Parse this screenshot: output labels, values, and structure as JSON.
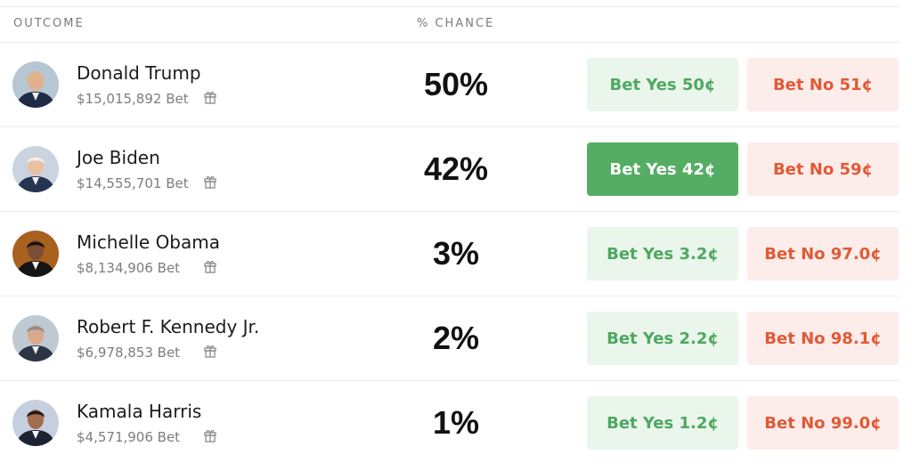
{
  "header": {
    "outcome_label": "OUTCOME",
    "chance_label": "% CHANCE"
  },
  "rows": [
    {
      "name": "Donald Trump",
      "volume": "$15,015,892 Bet",
      "chance": "50%",
      "bet_yes": "Bet Yes 50¢",
      "bet_no": "Bet No 51¢",
      "avatar_bg": "#b7c6d3",
      "suit": "#1f2a44",
      "hair": "#d9b98a",
      "skin": "#e2b08f"
    },
    {
      "name": "Joe Biden",
      "volume": "$14,555,701 Bet",
      "chance": "42%",
      "bet_yes": "Bet Yes 42¢",
      "bet_no": "Bet No 59¢",
      "avatar_bg": "#c9d4e0",
      "suit": "#243451",
      "hair": "#eeeeee",
      "skin": "#e8c0a4"
    },
    {
      "name": "Michelle Obama",
      "volume": "$8,134,906 Bet",
      "chance": "3%",
      "bet_yes": "Bet Yes 3.2¢",
      "bet_no": "Bet No 97.0¢",
      "avatar_bg": "#a8611f",
      "suit": "#151515",
      "hair": "#1a1310",
      "skin": "#7b4d33"
    },
    {
      "name": "Robert F. Kennedy Jr.",
      "volume": "$6,978,853 Bet",
      "chance": "2%",
      "bet_yes": "Bet Yes 2.2¢",
      "bet_no": "Bet No 98.1¢",
      "avatar_bg": "#bfc9d2",
      "suit": "#2c3445",
      "hair": "#8e8e8e",
      "skin": "#d9a98c"
    },
    {
      "name": "Kamala Harris",
      "volume": "$4,571,906 Bet",
      "chance": "1%",
      "bet_yes": "Bet Yes 1.2¢",
      "bet_no": "Bet No 99.0¢",
      "avatar_bg": "#c6cfe0",
      "suit": "#1d2233",
      "hair": "#241812",
      "skin": "#a46d4e"
    }
  ],
  "active_bet_row": 1,
  "colors": {
    "yes_text": "#4ea85f",
    "yes_bg": "#eaf5ec",
    "yes_active_bg": "#55ad63",
    "no_text": "#e05a35",
    "no_bg": "#fcecea"
  },
  "icons": {
    "gift": "gift-icon"
  }
}
